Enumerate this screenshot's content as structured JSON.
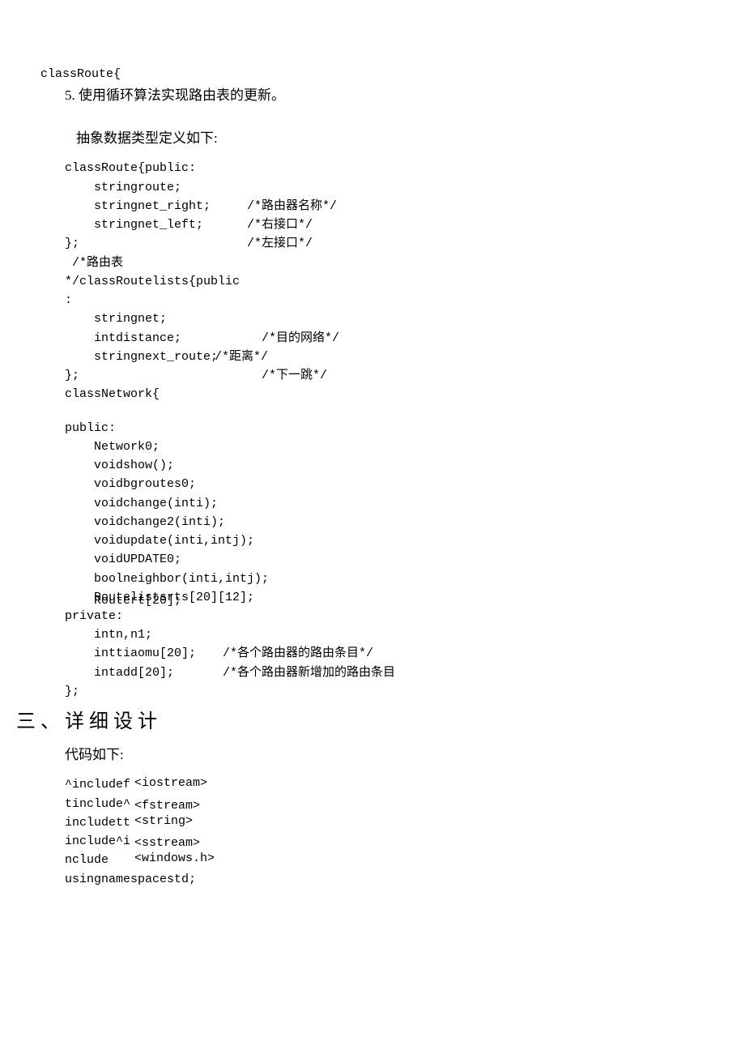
{
  "top_line": "classRoute{",
  "numbered": "5. 使用循环算法实现路由表的更新。",
  "abstract_title": "抽象数据类型定义如下:",
  "block1_left": [
    "classRoute{public:",
    "    stringroute;",
    "    stringnet_right;",
    "    stringnet_left;",
    "};",
    " /*路由表",
    "*/classRoutelists{public",
    ":",
    "    stringnet;",
    "    intdistance;",
    "    stringnext_route;",
    "};",
    "classNetwork{"
  ],
  "block1_right": [
    "",
    "",
    "/*路由器名称*/",
    "/*右接口*/",
    "/*左接口*/",
    "",
    "",
    "",
    "",
    "  /*目的网络*/",
    "/*距离*/",
    "  /*下一跳*/",
    ""
  ],
  "block1_right_offsets": [
    0,
    0,
    0,
    0,
    0,
    0,
    0,
    0,
    0,
    0,
    -40,
    0,
    0
  ],
  "public_block": [
    "public:",
    "    Network0;",
    "    voidshow();",
    "    voidbgroutes0;",
    "    voidchange(inti);",
    "    voidchange2(inti);",
    "    voidupdate(inti,intj);",
    "    voidUPDATE0;",
    "    boolneighbor(inti,intj);",
    "    Routelistsrts[20][12];",
    "    Routert[20];",
    "private:",
    "    intn,n1;"
  ],
  "private_left": [
    "    inttiaomu[20];",
    "    intadd[20];",
    "};"
  ],
  "private_right": [
    "/*各个路由器的路由条目*/",
    "/*各个路由器新增加的路由条目",
    ""
  ],
  "h2": "三、详细设计",
  "code_title": "代码如下:",
  "inc_left": [
    "^includef",
    "tinclude^",
    "includett",
    "include^i",
    "nclude",
    "usingnamespacestd;"
  ],
  "inc_right": [
    "<iostream>",
    "<fstream>",
    "<string>",
    "<sstream>",
    "<windows.h>",
    ""
  ]
}
